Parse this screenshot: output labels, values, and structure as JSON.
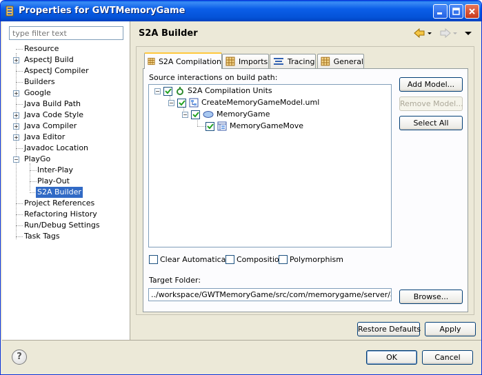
{
  "window": {
    "title": "Properties for GWTMemoryGame"
  },
  "sidebar": {
    "filter_placeholder": "type filter text",
    "items": [
      {
        "label": "Resource",
        "expandable": false
      },
      {
        "label": "AspectJ Build",
        "expandable": true
      },
      {
        "label": "AspectJ Compiler",
        "expandable": false
      },
      {
        "label": "Builders",
        "expandable": false
      },
      {
        "label": "Google",
        "expandable": true
      },
      {
        "label": "Java Build Path",
        "expandable": false
      },
      {
        "label": "Java Code Style",
        "expandable": true
      },
      {
        "label": "Java Compiler",
        "expandable": true
      },
      {
        "label": "Java Editor",
        "expandable": true
      },
      {
        "label": "Javadoc Location",
        "expandable": false
      },
      {
        "label": "PlayGo",
        "expandable": true,
        "expanded": true
      },
      {
        "label": "Inter-Play",
        "child": true
      },
      {
        "label": "Play-Out",
        "child": true
      },
      {
        "label": "S2A Builder",
        "child": true,
        "selected": true
      },
      {
        "label": "Project References",
        "expandable": false
      },
      {
        "label": "Refactoring History",
        "expandable": false
      },
      {
        "label": "Run/Debug Settings",
        "expandable": false
      },
      {
        "label": "Task Tags",
        "expandable": false
      }
    ]
  },
  "main": {
    "title": "S2A Builder",
    "tabs": [
      {
        "label": "S2A Compilation",
        "active": true
      },
      {
        "label": "Imports"
      },
      {
        "label": "Tracing"
      },
      {
        "label": "General"
      }
    ],
    "source_label": "Source interactions on build path:",
    "tree": [
      {
        "label": "S2A Compilation Units",
        "level": 0,
        "checked": true,
        "expander": "−"
      },
      {
        "label": "CreateMemoryGameModel.uml",
        "level": 1,
        "checked": true,
        "expander": "−"
      },
      {
        "label": "MemoryGame",
        "level": 2,
        "checked": true,
        "expander": "−"
      },
      {
        "label": "MemoryGameMove",
        "level": 3,
        "checked": true
      }
    ],
    "buttons": {
      "add_model": "Add Model...",
      "remove_model": "Remove Model...",
      "select_all": "Select All",
      "browse": "Browse..."
    },
    "options": {
      "clear_automatically": "Clear Automatically",
      "composition": "Composition",
      "polymorphism": "Polymorphism"
    },
    "target_folder_label": "Target Folder:",
    "target_folder_value": "../workspace/GWTMemoryGame/src/com/memorygame/server/aspects"
  },
  "footer": {
    "restore_defaults": "Restore Defaults",
    "apply": "Apply",
    "ok": "OK",
    "cancel": "Cancel"
  },
  "colors": {
    "selection": "#316ac5",
    "titlebar": "#0453d8",
    "dialog_bg": "#ece9d8"
  }
}
